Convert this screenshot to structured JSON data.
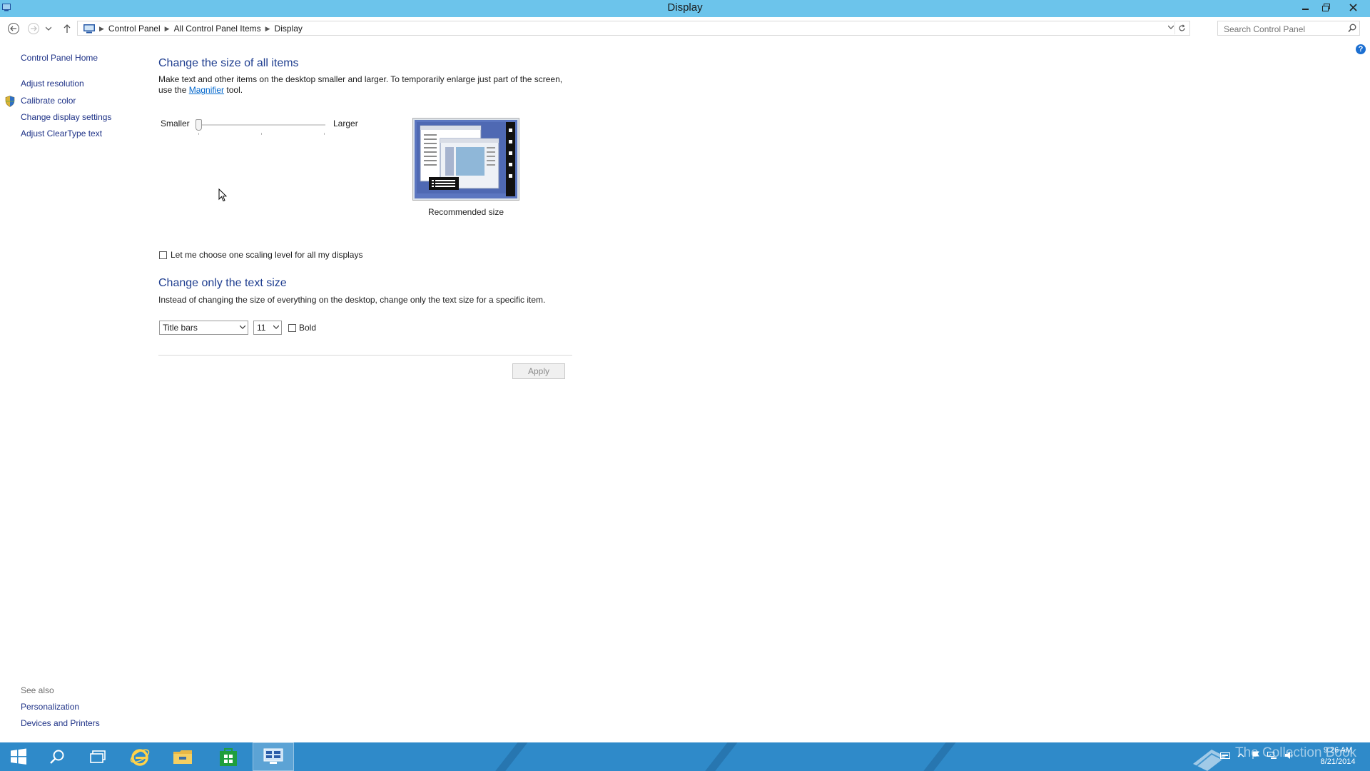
{
  "window": {
    "title": "Display"
  },
  "navbar": {
    "breadcrumbs": [
      "Control Panel",
      "All Control Panel Items",
      "Display"
    ],
    "search_placeholder": "Search Control Panel"
  },
  "sidebar": {
    "home": "Control Panel Home",
    "items": [
      {
        "label": "Adjust resolution"
      },
      {
        "label": "Calibrate color"
      },
      {
        "label": "Change display settings"
      },
      {
        "label": "Adjust ClearType text"
      }
    ],
    "see_also_title": "See also",
    "see_also": [
      {
        "label": "Personalization"
      },
      {
        "label": "Devices and Printers"
      }
    ]
  },
  "main": {
    "size_heading": "Change the size of all items",
    "size_desc_before": "Make text and other items on the desktop smaller and larger. To temporarily enlarge just part of the screen, use the ",
    "magnifier_link": "Magnifier",
    "size_desc_after": " tool.",
    "slider": {
      "min_label": "Smaller",
      "max_label": "Larger",
      "value": 0
    },
    "preview_caption": "Recommended size",
    "scaling_checkbox_label": "Let me choose one scaling level for all my displays",
    "scaling_checked": false,
    "text_heading": "Change only the text size",
    "text_desc": "Instead of changing the size of everything on the desktop, change only the text size for a specific item.",
    "item_select": "Title bars",
    "size_select": "11",
    "bold_label": "Bold",
    "bold_checked": false,
    "apply_label": "Apply"
  },
  "taskbar": {
    "watermark": "The Collection Book",
    "clock_time": "9:26 AM",
    "clock_date": "8/21/2014"
  },
  "colors": {
    "titlebar": "#6cc4eb",
    "taskbar": "#2f8ac9",
    "link": "#1e3287",
    "heading": "#1e3d8f"
  }
}
